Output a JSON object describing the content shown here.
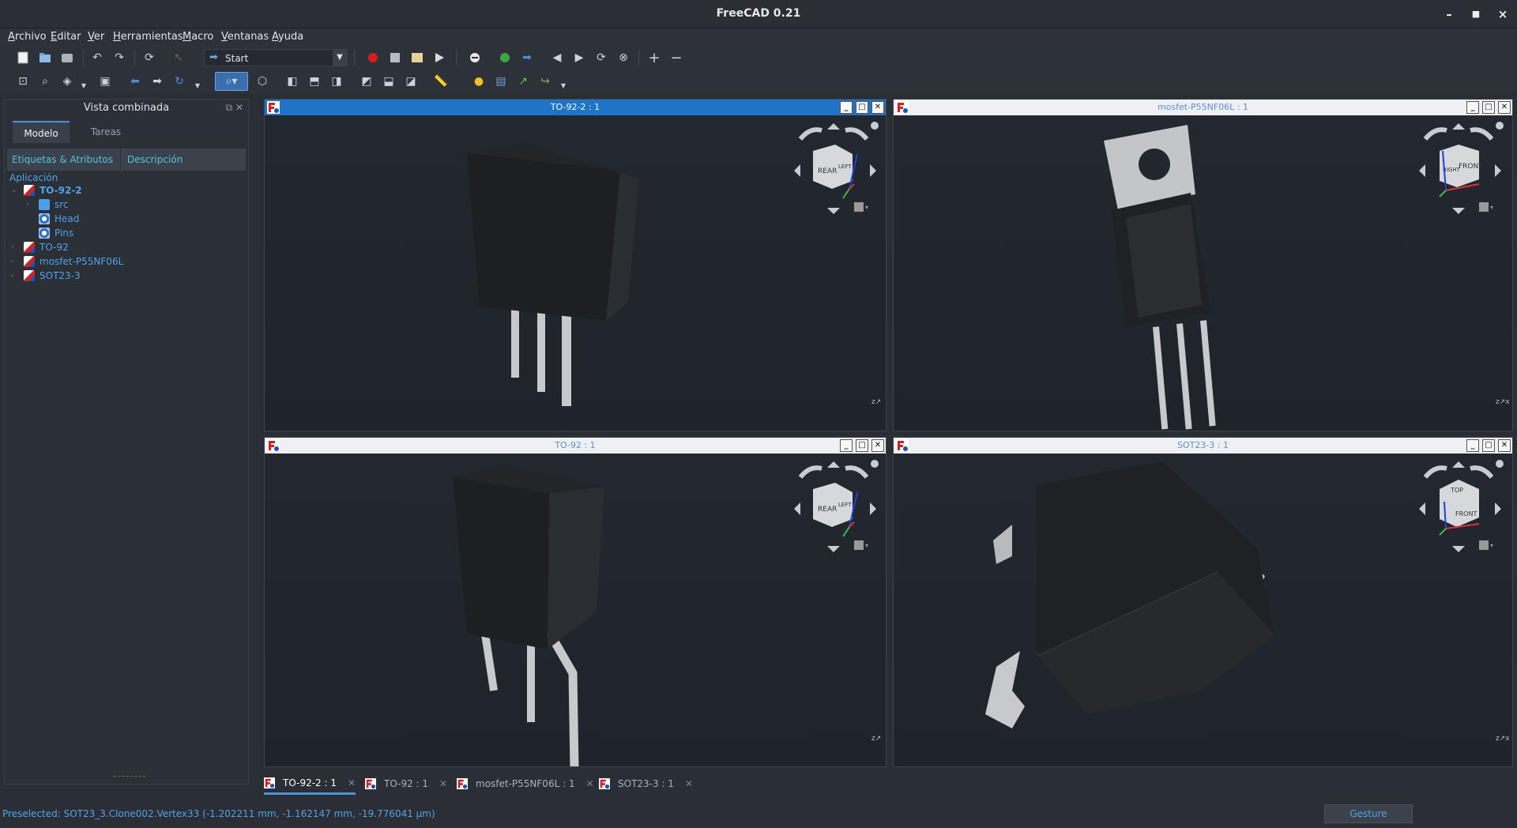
{
  "window": {
    "title": "FreeCAD 0.21"
  },
  "menu": [
    "Archivo",
    "Editar",
    "Ver",
    "Herramientas",
    "Macro",
    "Ventanas",
    "Ayuda"
  ],
  "toolbar": {
    "workbench": "Start"
  },
  "combo": {
    "title": "Vista combinada",
    "tabs": [
      "Modelo",
      "Tareas"
    ],
    "columns": [
      "Etiquetas & Atributos",
      "Descripción"
    ],
    "app_label": "Aplicación",
    "tree": [
      {
        "label": "TO-92-2",
        "icon": "document-icon"
      },
      {
        "label": "src",
        "icon": "folder-icon"
      },
      {
        "label": "Head",
        "icon": "body-icon"
      },
      {
        "label": "Pins",
        "icon": "body-icon"
      },
      {
        "label": "TO-92",
        "icon": "document-icon"
      },
      {
        "label": "mosfet-P55NF06L",
        "icon": "document-icon"
      },
      {
        "label": "SOT23-3",
        "icon": "document-icon"
      }
    ]
  },
  "views": [
    {
      "title": "TO-92-2 : 1",
      "cube": [
        "REAR",
        "LEFT"
      ]
    },
    {
      "title": "mosfet-P55NF06L : 1",
      "cube": [
        "RIGHT",
        "FRONT"
      ]
    },
    {
      "title": "TO-92 : 1",
      "cube": [
        "REAR",
        "LEFT"
      ]
    },
    {
      "title": "SOT23-3 : 1",
      "cube": [
        "TOP",
        "FRONT"
      ]
    }
  ],
  "doc_tabs": [
    "TO-92-2 : 1",
    "TO-92 : 1",
    "mosfet-P55NF06L : 1",
    "SOT23-3 : 1"
  ],
  "status": {
    "message": "Preselected: SOT23_3.Clone002.Vertex33 (-1.202211 mm, -1.162147 mm, -19.776041 µm)",
    "navigation": "Gesture"
  },
  "colors": {
    "accent": "#1f74c8",
    "link": "#4fa3ea",
    "header_cyan": "#4fc6e0"
  }
}
